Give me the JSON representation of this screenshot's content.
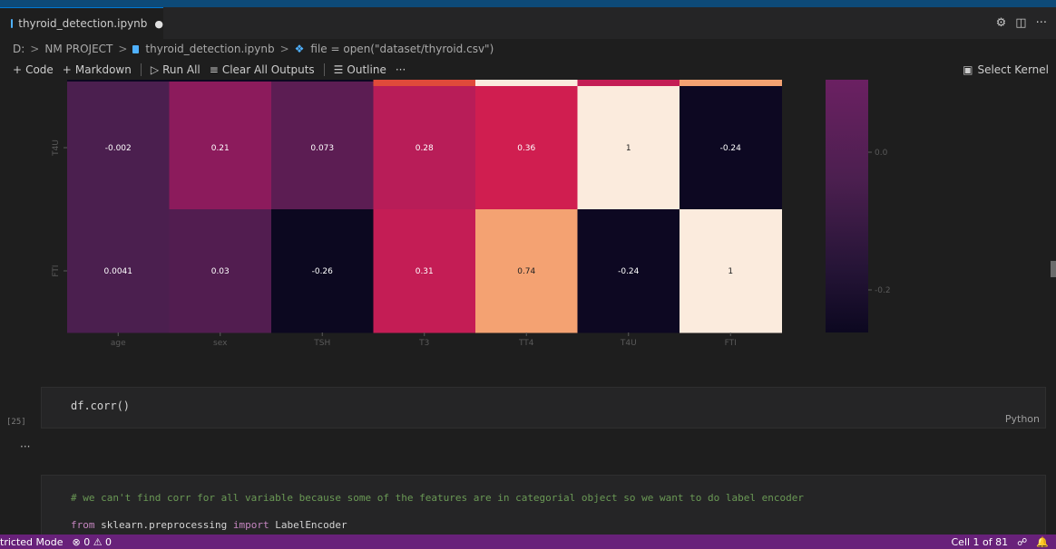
{
  "tab": {
    "title": "thyroid_detection.ipynb",
    "dirty_indicator": "●"
  },
  "tab_actions": {
    "settings_icon": "⚙",
    "split_icon": "◫",
    "more_icon": "···"
  },
  "breadcrumb": {
    "items": [
      "D:",
      "NM PROJECT",
      "thyroid_detection.ipynb",
      "file = open(\"dataset/thyroid.csv\")"
    ],
    "separator": ">"
  },
  "toolbar": {
    "code_label": "Code",
    "markdown_label": "Markdown",
    "run_all_label": "Run All",
    "clear_outputs_label": "Clear All Outputs",
    "outline_label": "Outline",
    "more_label": "···",
    "kernel_label": "Select Kernel"
  },
  "chart_data": {
    "type": "heatmap",
    "visible_rows": [
      "T4U",
      "FTI"
    ],
    "columns": [
      "age",
      "sex",
      "TSH",
      "T3",
      "TT4",
      "T4U",
      "FTI"
    ],
    "values": [
      [
        -0.002,
        0.21,
        0.073,
        0.28,
        0.36,
        1,
        -0.24
      ],
      [
        0.0041,
        0.03,
        -0.26,
        0.31,
        0.74,
        -0.24,
        1
      ]
    ],
    "value_labels": [
      [
        "-0.002",
        "0.21",
        "0.073",
        "0.28",
        "0.36",
        "1",
        "-0.24"
      ],
      [
        "0.0041",
        "0.03",
        "-0.26",
        "0.31",
        "0.74",
        "-0.24",
        "1"
      ]
    ],
    "colorbar_ticks": [
      "0.0",
      "-0.2"
    ],
    "colors": {
      "-0.26": "#0c0820",
      "-0.24": "#0d0822",
      "-0.002": "#4b1f4f",
      "0.0041": "#4b1f4f",
      "0.03": "#521d50",
      "0.073": "#5c1d53",
      "0.21": "#8c1b5c",
      "0.28": "#b81d58",
      "0.31": "#c41d55",
      "0.36": "#d01e50",
      "0.74": "#f4a272",
      "1": "#fbebdd"
    }
  },
  "cell1": {
    "code": "df.corr()",
    "exec_count": "[25]",
    "language": "Python"
  },
  "output_more": "···",
  "cell2": {
    "comment": "# we can't find corr for all variable because some of the features are in categorial object so we want to do label encoder",
    "line2_keyword1": "from",
    "line2_module": " sklearn.preprocessing ",
    "line2_keyword2": "import",
    "line2_name": " LabelEncoder"
  },
  "statusbar": {
    "mode": "tricted Mode",
    "problems": "⊗ 0 ⚠ 0",
    "cell_position": "Cell 1 of 81",
    "bell_icon": "🔔"
  }
}
